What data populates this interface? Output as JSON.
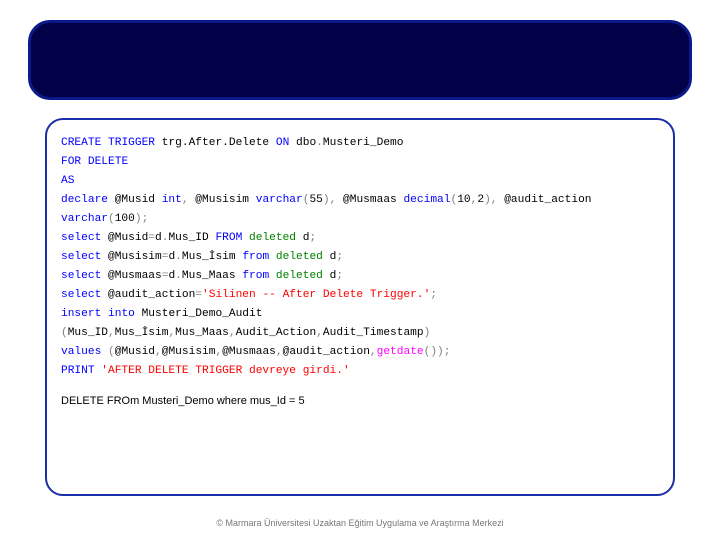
{
  "code": {
    "l1_a": "CREATE",
    "l1_b": " TRIGGER",
    "l1_c": " trg.After.Delete ",
    "l1_d": "ON",
    "l1_e": " dbo",
    "l1_f": ".",
    "l1_g": "Musteri_Demo",
    "l2_a": "FOR",
    "l2_b": " DELETE",
    "l3_a": "AS",
    "l4_a": "declare",
    "l4_b": " @Musid ",
    "l4_c": "int",
    "l4_d": ",",
    "l4_e": " @Musisim ",
    "l4_f": "varchar",
    "l4_g": "(",
    "l4_h": "55",
    "l4_i": "),",
    "l4_j": " @Musmaas ",
    "l4_k": "decimal",
    "l4_l": "(",
    "l4_m": "10",
    "l4_n": ",",
    "l4_o": "2",
    "l4_p": "),",
    "l4_q": " @audit_action ",
    "l5_a": "varchar",
    "l5_b": "(",
    "l5_c": "100",
    "l5_d": ");",
    "l6_a": "select",
    "l6_b": " @Musid",
    "l6_c": "=",
    "l6_d": "d",
    "l6_e": ".",
    "l6_f": "Mus_ID ",
    "l6_g": "FROM",
    "l6_h": " deleted",
    "l6_i": " d",
    "l6_j": ";",
    "l7_a": "select",
    "l7_b": " @Musisim",
    "l7_c": "=",
    "l7_d": "d",
    "l7_e": ".",
    "l7_f": "Mus_İsim ",
    "l7_g": "from",
    "l7_h": " deleted",
    "l7_i": " d",
    "l7_j": ";",
    "l8_a": "select",
    "l8_b": " @Musmaas",
    "l8_c": "=",
    "l8_d": "d",
    "l8_e": ".",
    "l8_f": "Mus_Maas ",
    "l8_g": "from",
    "l8_h": " deleted",
    "l8_i": " d",
    "l8_j": ";",
    "l9_a": "select",
    "l9_b": " @audit_action",
    "l9_c": "=",
    "l9_d": "'Silinen -- After Delete Trigger.'",
    "l9_e": ";",
    "l10_a": "insert",
    "l10_b": " into",
    "l10_c": " Musteri_Demo_Audit",
    "l11_a": "(",
    "l11_b": "Mus_ID",
    "l11_c": ",",
    "l11_d": "Mus_İsim",
    "l11_e": ",",
    "l11_f": "Mus_Maas",
    "l11_g": ",",
    "l11_h": "Audit_Action",
    "l11_i": ",",
    "l11_j": "Audit_Timestamp",
    "l11_k": ")",
    "l12_a": "values",
    "l12_b": " (",
    "l12_c": "@Musid",
    "l12_d": ",",
    "l12_e": "@Musisim",
    "l12_f": ",",
    "l12_g": "@Musmaas",
    "l12_h": ",",
    "l12_i": "@audit_action",
    "l12_j": ",",
    "l12_k": "getdate",
    "l12_l": "());",
    "l13_a": "PRINT",
    "l13_b": " 'AFTER DELETE TRIGGER devreye girdi.'",
    "delete_stmt": "DELETE FROm Musteri_Demo where mus_Id = 5"
  },
  "footer": "© Marmara Üniversitesi Uzaktan Eğitim Uygulama ve Araştırma Merkezi"
}
